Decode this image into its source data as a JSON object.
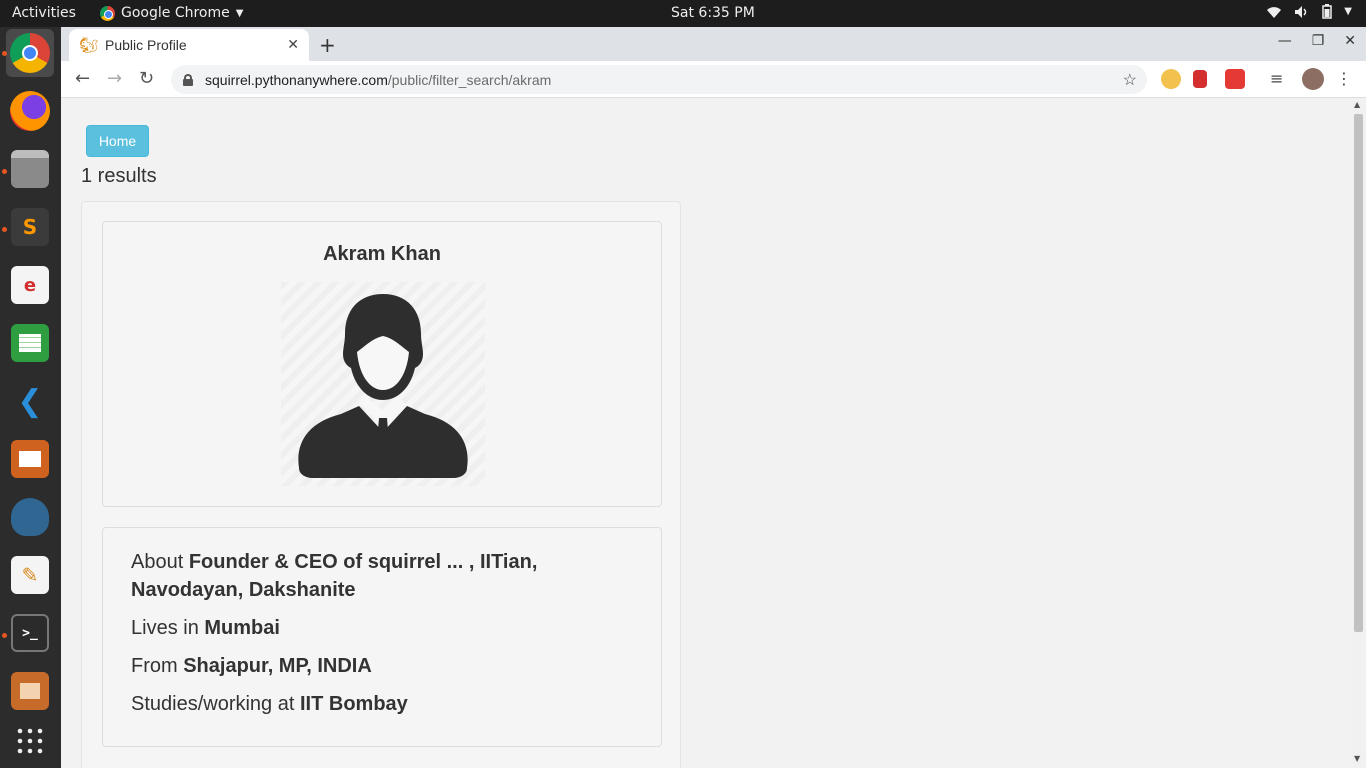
{
  "system": {
    "activities": "Activities",
    "app_name": "Google Chrome",
    "clock": "Sat  6:35 PM"
  },
  "browser": {
    "tab_title": "Public Profile",
    "url_host": "squirrel.pythonanywhere.com",
    "url_path": "/public/filter_search/akram"
  },
  "page": {
    "home_label": "Home",
    "results_text": "1 results",
    "profile": {
      "name": "Akram Khan",
      "about_prefix": "About ",
      "about": "Founder & CEO of squirrel ... , IITian, Navodayan, Dakshanite",
      "lives_prefix": "Lives in ",
      "lives": "Mumbai",
      "from_prefix": "From ",
      "from": "Shajapur, MP, INDIA",
      "studies_prefix": "Studies/working at ",
      "studies": "IIT Bombay"
    }
  },
  "colors": {
    "home_button": "#5bc0de",
    "ubuntu_accent": "#e95420"
  }
}
